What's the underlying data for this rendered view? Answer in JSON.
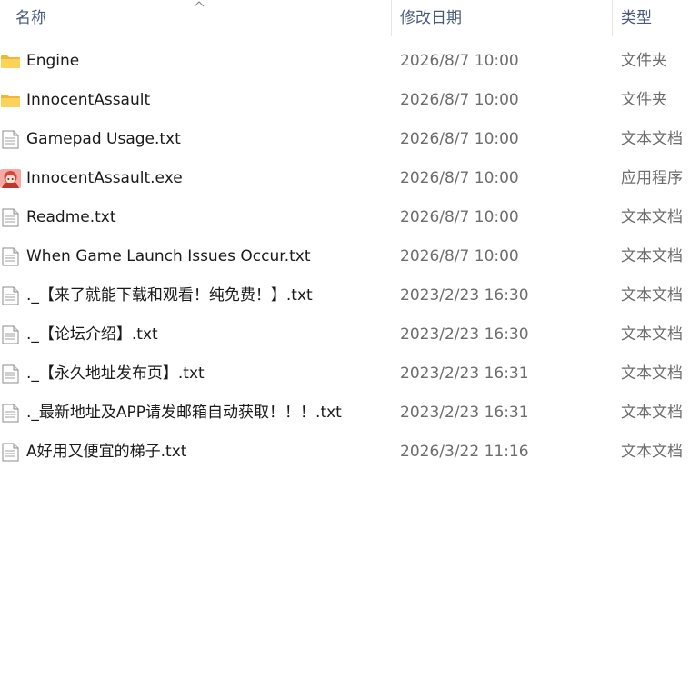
{
  "columns": {
    "name": "名称",
    "date": "修改日期",
    "type": "类型"
  },
  "icons": {
    "folder": "folder-icon",
    "text": "text-file-icon",
    "app": "app-icon"
  },
  "colors": {
    "folder": "#f6c23e",
    "header_text": "#4a5a78",
    "secondary_text": "#6d6d6d"
  },
  "files": [
    {
      "name": "Engine",
      "date": "2026/8/7 10:00",
      "type": "文件夹",
      "icon": "folder"
    },
    {
      "name": "InnocentAssault",
      "date": "2026/8/7 10:00",
      "type": "文件夹",
      "icon": "folder"
    },
    {
      "name": "Gamepad Usage.txt",
      "date": "2026/8/7 10:00",
      "type": "文本文档",
      "icon": "text"
    },
    {
      "name": "InnocentAssault.exe",
      "date": "2026/8/7 10:00",
      "type": "应用程序",
      "icon": "app"
    },
    {
      "name": "Readme.txt",
      "date": "2026/8/7 10:00",
      "type": "文本文档",
      "icon": "text"
    },
    {
      "name": "When Game Launch Issues Occur.txt",
      "date": "2026/8/7 10:00",
      "type": "文本文档",
      "icon": "text"
    },
    {
      "name": "._【来了就能下载和观看！纯免费！】.txt",
      "date": "2023/2/23 16:30",
      "type": "文本文档",
      "icon": "text"
    },
    {
      "name": "._【论坛介绍】.txt",
      "date": "2023/2/23 16:30",
      "type": "文本文档",
      "icon": "text"
    },
    {
      "name": "._【永久地址发布页】.txt",
      "date": "2023/2/23 16:31",
      "type": "文本文档",
      "icon": "text"
    },
    {
      "name": "._最新地址及APP请发邮箱自动获取！！！.txt",
      "date": "2023/2/23 16:31",
      "type": "文本文档",
      "icon": "text"
    },
    {
      "name": "A好用又便宜的梯子.txt",
      "date": "2026/3/22 11:16",
      "type": "文本文档",
      "icon": "text"
    }
  ]
}
